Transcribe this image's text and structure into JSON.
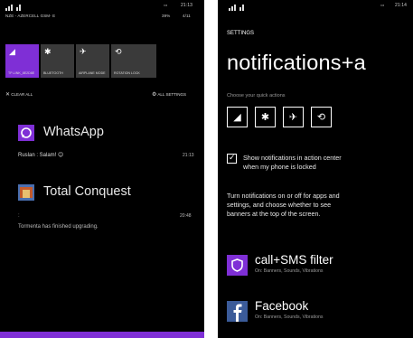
{
  "left": {
    "status": {
      "line1": "NZE - AZERCELL GSM- E",
      "clock": "21:13",
      "battery": "39%",
      "date": "4/11"
    },
    "quick_actions": [
      {
        "icon": "wifi-icon",
        "glyph": "◢",
        "label": "TP-LINK_8E2D8E",
        "active": true
      },
      {
        "icon": "bluetooth-icon",
        "glyph": "✱",
        "label": "BLUETOOTH",
        "active": false
      },
      {
        "icon": "airplane-icon",
        "glyph": "✈",
        "label": "AIRPLANE MODE",
        "active": false
      },
      {
        "icon": "rotation-lock-icon",
        "glyph": "⟲",
        "label": "ROTATION LOCK",
        "active": false
      }
    ],
    "clear_all": "CLEAR ALL",
    "all_settings": "ALL SETTINGS",
    "notifications": [
      {
        "app": "WhatsApp",
        "message": "Ruslan : Salam! 😊",
        "time": "21:13",
        "accent": "#7f2fd6"
      },
      {
        "app": "Total Conquest",
        "title_line": ":",
        "message": "Tormenta has finished upgrading.",
        "time": "20:48"
      }
    ],
    "accent": "#7f2fd6"
  },
  "right": {
    "clock": "21:14",
    "header": "SETTINGS",
    "title": "notifications+a",
    "choose_label": "Choose your quick actions",
    "quick_icons": [
      {
        "icon": "wifi-icon",
        "glyph": "◢"
      },
      {
        "icon": "bluetooth-icon",
        "glyph": "✱"
      },
      {
        "icon": "airplane-icon",
        "glyph": "✈"
      },
      {
        "icon": "rotation-lock-icon",
        "glyph": "⟲"
      }
    ],
    "checkbox_label_1": "Show notifications in action center",
    "checkbox_label_2": "when my phone is locked",
    "checkbox_checked": true,
    "desc_1": "Turn notifications on or off for apps and",
    "desc_2": "settings, and choose whether to see",
    "desc_3": "banners at the top of the screen.",
    "apps": [
      {
        "name": "call+SMS filter",
        "sub": "On: Banners, Sounds, Vibrations",
        "icon": "shield-icon",
        "color": "#7f2fd6"
      },
      {
        "name": "Facebook",
        "sub": "On: Banners, Sounds, Vibrations",
        "icon": "facebook-icon",
        "color": "#3b5b99"
      }
    ]
  }
}
